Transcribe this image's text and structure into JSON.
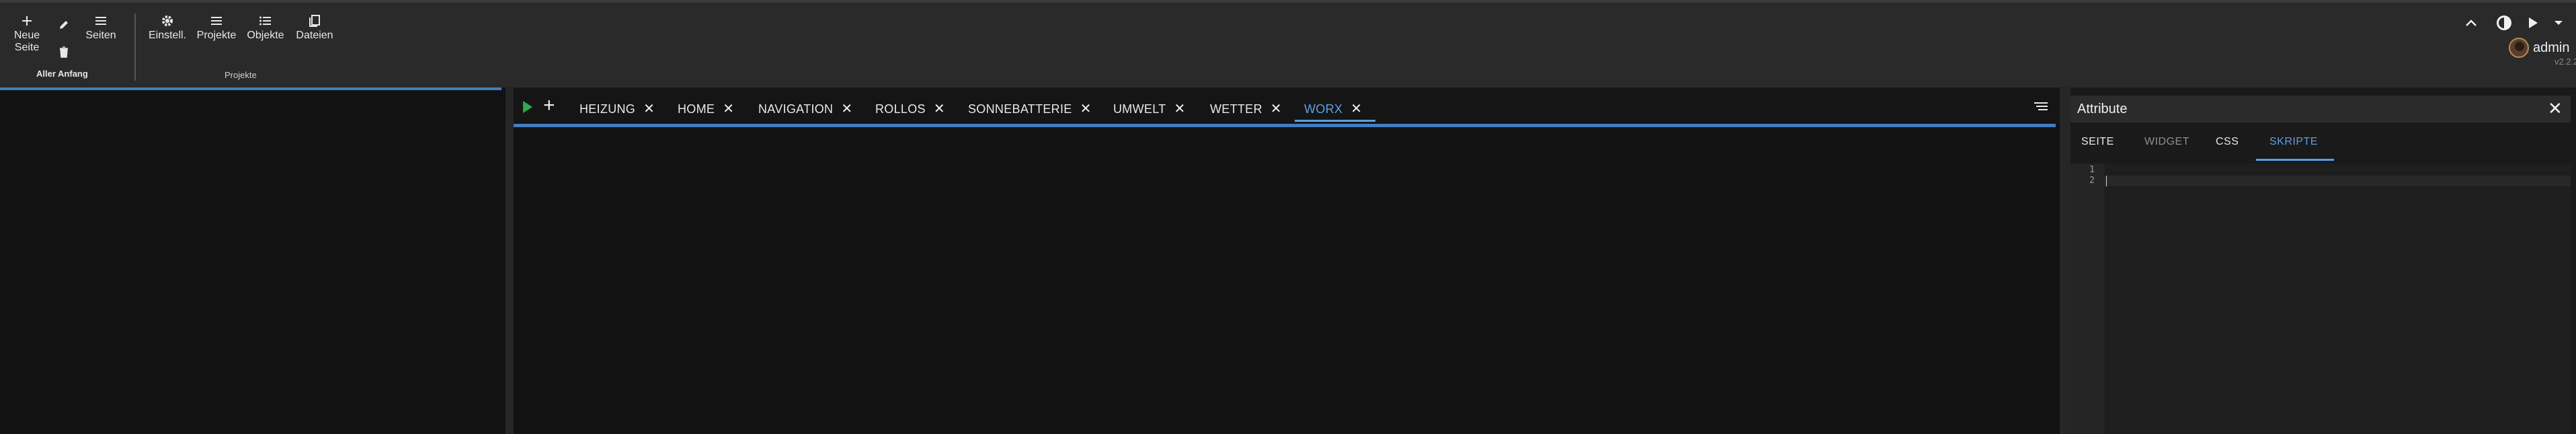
{
  "toolbar": {
    "page_group": {
      "new_page": "Neue\nSeite",
      "pages": "Seiten",
      "caption": "Aller Anfang"
    },
    "project_group": {
      "settings": "Einstell.",
      "projects": "Projekte",
      "objects": "Objekte",
      "files": "Dateien",
      "caption": "Projekte"
    },
    "user": {
      "name": "admin",
      "version": "v2.2.2"
    }
  },
  "tabs": [
    {
      "label": "HEIZUNG",
      "active": false
    },
    {
      "label": "HOME",
      "active": false
    },
    {
      "label": "NAVIGATION",
      "active": false
    },
    {
      "label": "ROLLOS",
      "active": false
    },
    {
      "label": "SONNEBATTERIE",
      "active": false
    },
    {
      "label": "UMWELT",
      "active": false
    },
    {
      "label": "WETTER",
      "active": false
    },
    {
      "label": "WORX",
      "active": true
    }
  ],
  "attributes_panel": {
    "title": "Attribute",
    "tabs": [
      "SEITE",
      "WIDGET",
      "CSS",
      "SKRIPTE"
    ],
    "active_tab": "SKRIPTE",
    "line_numbers": [
      "1",
      "2"
    ]
  },
  "colors": {
    "accent": "#5aa0e6",
    "progress": "#3f7fbf",
    "run": "#2fa84f",
    "toolbar_bg": "#2a2a2a",
    "canvas_bg": "#121212"
  },
  "icons": {
    "new_page": "plus-icon",
    "edit": "pencil-icon",
    "delete": "trash-icon",
    "pages": "menu-icon",
    "settings": "gear-icon",
    "projects": "list-icon",
    "objects": "list-bullets-icon",
    "files": "files-icon",
    "collapse": "chevron-up-icon",
    "theme": "brightness-icon",
    "run": "play-icon",
    "dropdown": "caret-down-icon",
    "tab_menu": "sort-lines-icon"
  }
}
